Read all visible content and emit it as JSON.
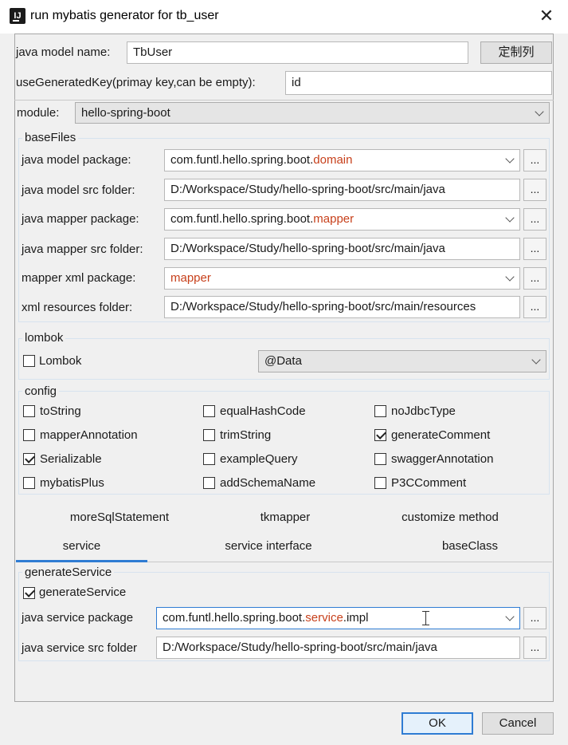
{
  "window": {
    "title": "run mybatis generator for tb_user",
    "icon_label": "IJ"
  },
  "top": {
    "model_name_label": "java model name:",
    "model_name_value": "TbUser",
    "customize_button": "定制列",
    "generated_key_label": "useGeneratedKey(primay key,can be empty):",
    "generated_key_value": "id",
    "module_label": "module:",
    "module_value": "hello-spring-boot"
  },
  "baseFiles": {
    "title": "baseFiles",
    "model_package_label": "java model package:",
    "model_package_prefix": "com.funtl.hello.spring.boot.",
    "model_package_hl": "domain",
    "model_src_label": "java model src folder:",
    "model_src_value": "D:/Workspace/Study/hello-spring-boot/src/main/java",
    "mapper_package_label": "java mapper package:",
    "mapper_package_prefix": "com.funtl.hello.spring.boot.",
    "mapper_package_hl": "mapper",
    "mapper_src_label": "java mapper src folder:",
    "mapper_src_value": "D:/Workspace/Study/hello-spring-boot/src/main/java",
    "xml_package_label": "mapper xml package:",
    "xml_package_hl": "mapper",
    "xml_folder_label": "xml resources folder:",
    "xml_folder_value": "D:/Workspace/Study/hello-spring-boot/src/main/resources",
    "browse": "..."
  },
  "lombok": {
    "title": "lombok",
    "checkbox_label": "Lombok",
    "checked": false,
    "select_value": "@Data"
  },
  "config": {
    "title": "config",
    "options": [
      {
        "label": "toString",
        "checked": false
      },
      {
        "label": "equalHashCode",
        "checked": false
      },
      {
        "label": "noJdbcType",
        "checked": false
      },
      {
        "label": "mapperAnnotation",
        "checked": false
      },
      {
        "label": "trimString",
        "checked": false
      },
      {
        "label": "generateComment",
        "checked": true
      },
      {
        "label": "Serializable",
        "checked": true
      },
      {
        "label": "exampleQuery",
        "checked": false
      },
      {
        "label": "swaggerAnnotation",
        "checked": false
      },
      {
        "label": "mybatisPlus",
        "checked": false
      },
      {
        "label": "addSchemaName",
        "checked": false
      },
      {
        "label": "P3CComment",
        "checked": false
      }
    ]
  },
  "tabs": {
    "row1": [
      "moreSqlStatement",
      "tkmapper",
      "customize method"
    ],
    "row2": [
      "service",
      "service interface",
      "baseClass"
    ],
    "active": "service",
    "accent_color": "#2f7cd3"
  },
  "generateService": {
    "title": "generateService",
    "checkbox_label": "generateService",
    "checked": true,
    "package_label": "java service package",
    "package_prefix": "com.funtl.hello.spring.boot.",
    "package_hl": "service",
    "package_suffix": ".impl",
    "src_label": "java service src folder",
    "src_value": "D:/Workspace/Study/hello-spring-boot/src/main/java",
    "browse": "..."
  },
  "footer": {
    "ok": "OK",
    "cancel": "Cancel"
  }
}
